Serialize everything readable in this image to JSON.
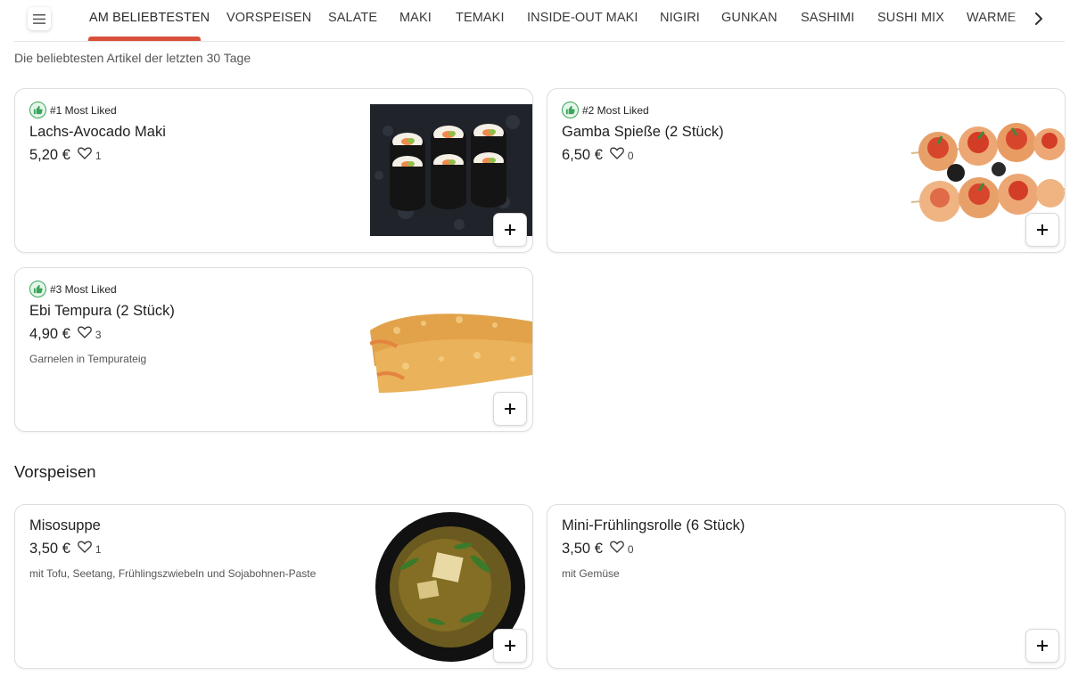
{
  "nav": {
    "tabs": [
      {
        "label": "AM BELIEBTESTEN",
        "active": true
      },
      {
        "label": "VORSPEISEN"
      },
      {
        "label": "SALATE"
      },
      {
        "label": "MAKI"
      },
      {
        "label": "TEMAKI"
      },
      {
        "label": "INSIDE-OUT MAKI"
      },
      {
        "label": "NIGIRI"
      },
      {
        "label": "GUNKAN"
      },
      {
        "label": "SASHIMI"
      },
      {
        "label": "SUSHI MIX"
      },
      {
        "label": "WARME"
      }
    ],
    "menu_icon": "hamburger-menu-icon",
    "next_icon": "chevron-right-icon",
    "accent_color": "#d9513c"
  },
  "popular": {
    "subtitle": "Die beliebtesten Artikel der letzten 30 Tage",
    "items": [
      {
        "badge": "#1 Most Liked",
        "name": "Lachs-Avocado Maki",
        "price": "5,20 €",
        "likes": "1",
        "description": ""
      },
      {
        "badge": "#2 Most Liked",
        "name": "Gamba Spieße (2 Stück)",
        "price": "6,50 €",
        "likes": "0",
        "description": ""
      },
      {
        "badge": "#3 Most Liked",
        "name": "Ebi Tempura (2 Stück)",
        "price": "4,90 €",
        "likes": "3",
        "description": "Garnelen in Tempurateig"
      }
    ]
  },
  "vorspeisen": {
    "title": "Vorspeisen",
    "items": [
      {
        "name": "Misosuppe",
        "price": "3,50 €",
        "likes": "1",
        "description": "mit Tofu, Seetang, Frühlingszwiebeln und Sojabohnen-Paste"
      },
      {
        "name": "Mini-Frühlingsrolle (6 Stück)",
        "price": "3,50 €",
        "likes": "0",
        "description": "mit Gemüse"
      }
    ]
  },
  "colors": {
    "badge_green": "#3aa55b",
    "tab_underline": "#d9513c"
  }
}
